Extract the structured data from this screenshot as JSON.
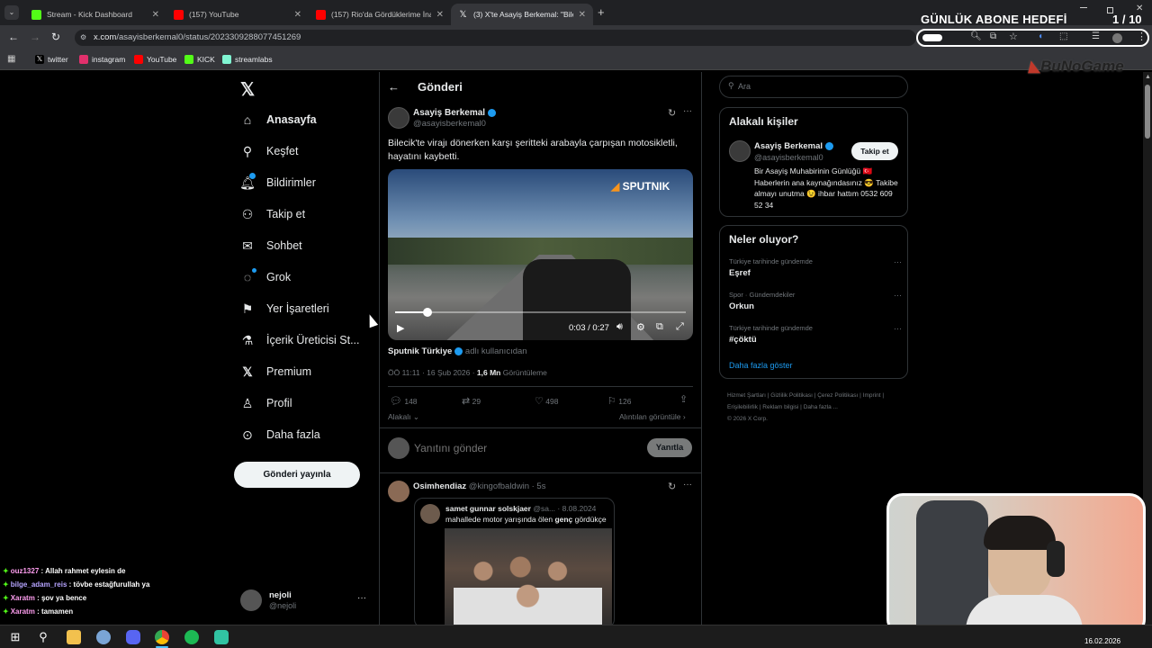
{
  "browser": {
    "tabs": [
      {
        "title": "Stream - Kick Dashboard",
        "color": "#53fc18"
      },
      {
        "title": "(157) YouTube",
        "color": "#ff0000"
      },
      {
        "title": "(157) Rio'da Gördüklerime İnan",
        "color": "#ff0000"
      },
      {
        "title": "(3) X'te Asayiş Berkemal: \"Bilecik",
        "color": "#ffffff"
      }
    ],
    "url_host": "x.com",
    "url_path": "/asayisberkemal0/status/2023309288077451269",
    "bookmarks": [
      "twitter",
      "instagram",
      "YouTube",
      "KICK",
      "streamlabs"
    ]
  },
  "overlay": {
    "goal_title": "GÜNLÜK ABONE HEDEFİ",
    "goal_count": "1 / 10",
    "logo": "BuNoGame"
  },
  "nav": {
    "items": [
      "Anasayfa",
      "Keşfet",
      "Bildirimler",
      "Takip et",
      "Sohbet",
      "Grok",
      "Yer İşaretleri",
      "İçerik Üreticisi St...",
      "Premium",
      "Profil",
      "Daha fazla"
    ],
    "post_button": "Gönderi yayınla",
    "account_name": "nejoli",
    "account_handle": "@nejoli"
  },
  "main": {
    "header": "Gönderi",
    "author_name": "Asayiş Berkemal",
    "author_handle": "@asayisberkemal0",
    "text": "Bilecik'te virajı dönerken karşı şeritteki arabayla çarpışan motosikletli, hayatını kaybetti.",
    "video_watermark": "SPUTNIK",
    "video_time": "0:03 / 0:27",
    "video_progress": 0.11,
    "source_name": "Sputnik Türkiye",
    "source_suffix": "adlı kullanıcıdan",
    "timestamp": "ÖÖ 11:11 · 16 Şub 2026 · ",
    "views": "1,6 Mn",
    "views_label": "Görüntüleme",
    "stats": {
      "replies": "148",
      "reposts": "29",
      "likes": "498",
      "bookmarks": "126"
    },
    "relevant": "Alakalı",
    "quotes_link": "Alıntılan görüntüle",
    "reply_placeholder": "Yanıtını gönder",
    "reply_button": "Yanıtla",
    "reply": {
      "name": "Osimhendiaz",
      "handle": "@kingofbaldwin · 5s",
      "quoted_name": "samet gunnar solskjaer",
      "quoted_meta": "@sa... · 8.08.2024",
      "quoted_text_pre": "mahallede motor yarışında ölen ",
      "quoted_text_bold": "genç",
      "quoted_text_post": " gördükçe"
    }
  },
  "right": {
    "search_placeholder": "Ara",
    "related_title": "Alakalı kişiler",
    "related_name": "Asayiş Berkemal",
    "related_handle": "@asayisberkemal0",
    "follow_button": "Takip et",
    "bio": "Bir Asayiş Muhabirinin Günlüğü 🇹🇷 Haberlerin ana kaynağındasınız 😎 Takibe almayı unutma 😉 ihbar hattım 0532 609 52 34",
    "trends_title": "Neler oluyor?",
    "trends": [
      {
        "context": "Türkiye tarihinde gündemde",
        "name": "Eşref"
      },
      {
        "context": "Spor · Gündemdekiler",
        "name": "Orkun"
      },
      {
        "context": "Türkiye tarihinde gündemde",
        "name": "#çöktü"
      }
    ],
    "show_more": "Daha fazla göster",
    "footer": [
      "Hizmet Şartları",
      "Gizlilik Politikası",
      "Çerez Politikası",
      "Imprint",
      "Erişilebilirlik",
      "Reklam bilgisi",
      "Daha fazla ...",
      "© 2026 X Corp."
    ]
  },
  "chat": [
    {
      "user": "ouz1327",
      "msg": ": Allah rahmet eylesin de",
      "color": "#ff9ef0"
    },
    {
      "user": "bilge_adam_reis",
      "msg": ": tövbe estağfurullah ya",
      "color": "#b6a4ff"
    },
    {
      "user": "Xaratm",
      "msg": ": şov ya bence",
      "color": "#ff9ef0"
    },
    {
      "user": "Xaratm",
      "msg": ": tamamen",
      "color": "#ff9ef0"
    }
  ],
  "taskbar": {
    "date": "16.02.2026"
  }
}
